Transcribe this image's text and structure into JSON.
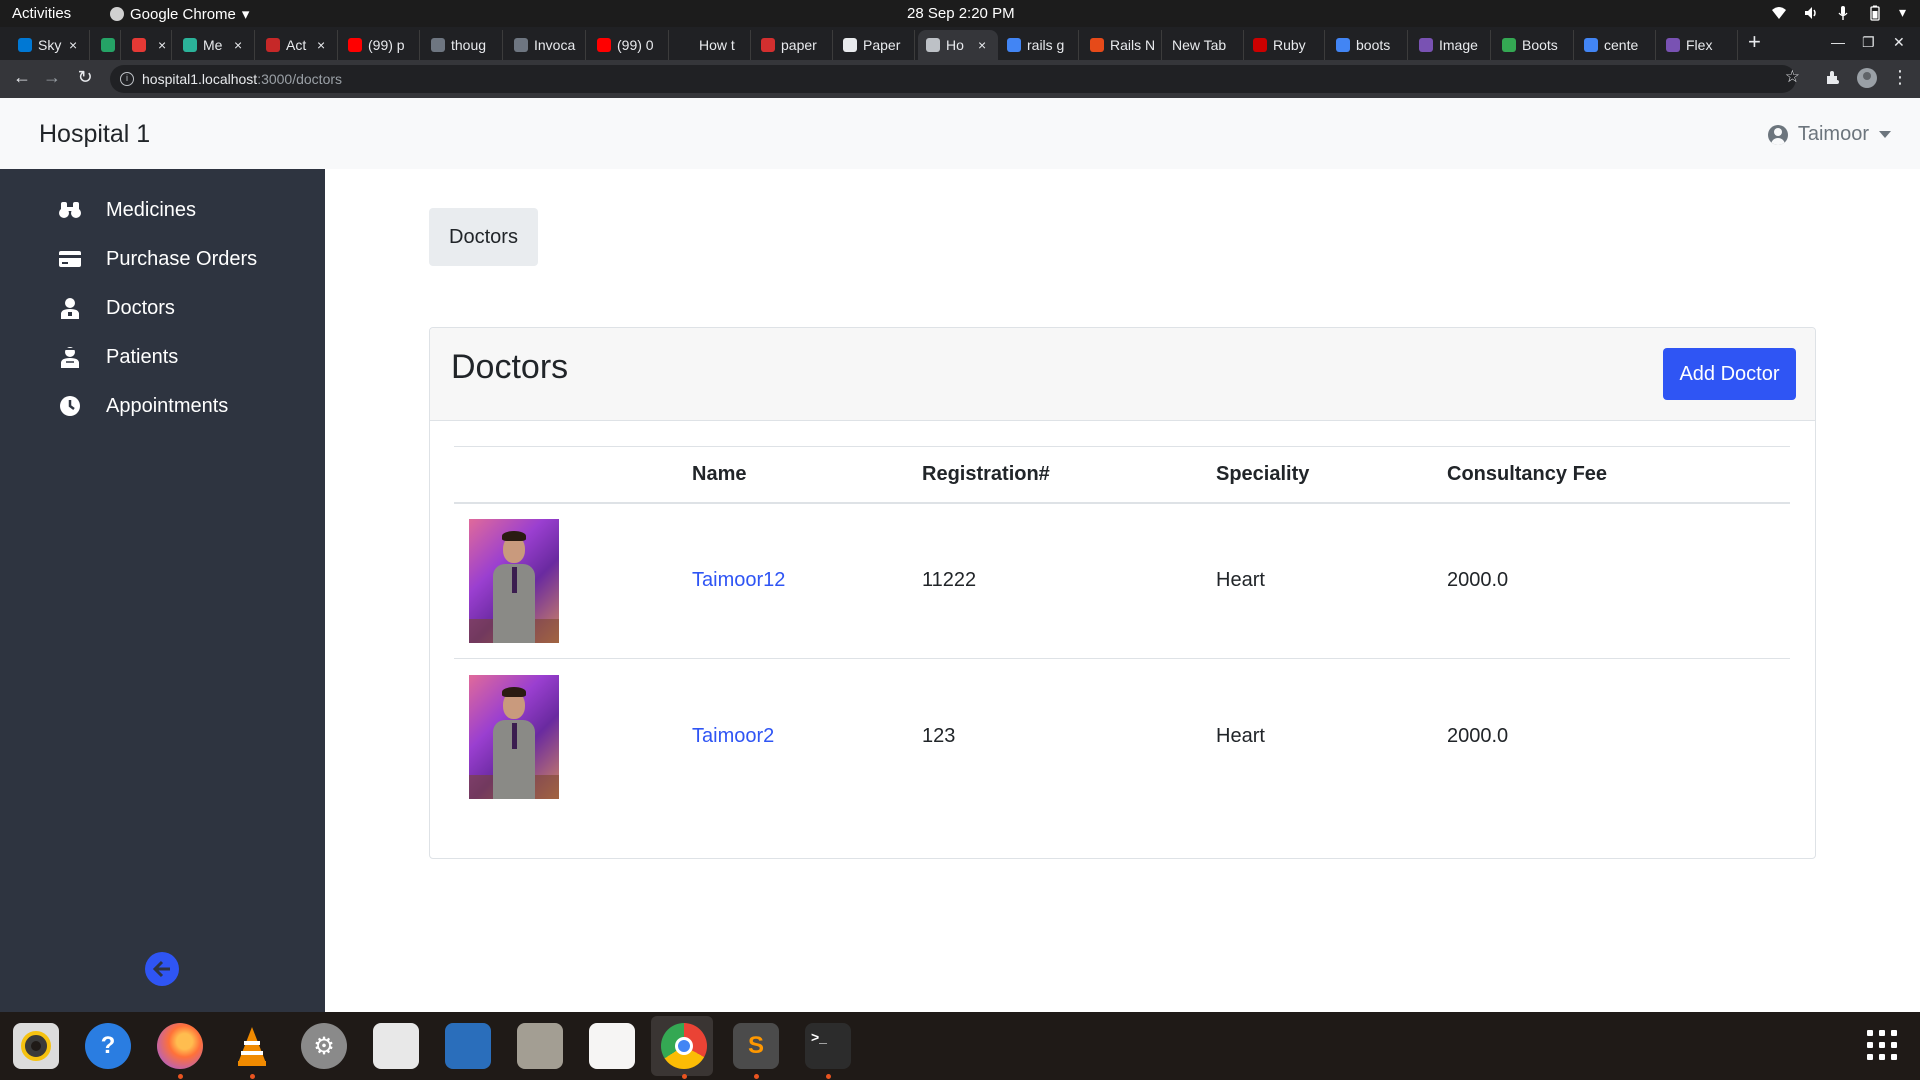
{
  "system": {
    "activities": "Activities",
    "app_name": "Google Chrome",
    "clock": "28 Sep  2:20 PM"
  },
  "browser": {
    "tabs": [
      {
        "label": "Sky",
        "fav_color": "#0078d4",
        "close": "×"
      },
      {
        "label": "",
        "fav_color": "#25a366",
        "close": ""
      },
      {
        "label": "",
        "fav_color": "#e53935",
        "close": "×"
      },
      {
        "label": "Me",
        "fav_color": "#2bb39a",
        "close": "×"
      },
      {
        "label": "Act",
        "fav_color": "#c62828",
        "close": "×"
      },
      {
        "label": "(99) p",
        "fav_color": "#ff0000",
        "close": ""
      },
      {
        "label": "thoug",
        "fav_color": "#6e7681",
        "close": ""
      },
      {
        "label": "Invoca",
        "fav_color": "#6e7681",
        "close": ""
      },
      {
        "label": "(99) 0",
        "fav_color": "#ff0000",
        "close": ""
      },
      {
        "label": "How t",
        "fav_color": "#202124",
        "close": ""
      },
      {
        "label": "paper",
        "fav_color": "#d32f2f",
        "close": ""
      },
      {
        "label": "Paper",
        "fav_color": "#e8eaed",
        "close": ""
      },
      {
        "label": "Ho",
        "fav_color": "#bdc1c6",
        "close": "×"
      },
      {
        "label": "rails g",
        "fav_color": "#4285f4",
        "close": ""
      },
      {
        "label": "Rails N",
        "fav_color": "#e64a19",
        "close": ""
      },
      {
        "label": "New Tab",
        "fav_color": "",
        "close": ""
      },
      {
        "label": "Ruby",
        "fav_color": "#cc0000",
        "close": ""
      },
      {
        "label": "boots",
        "fav_color": "#4285f4",
        "close": ""
      },
      {
        "label": "Image",
        "fav_color": "#7952b3",
        "close": ""
      },
      {
        "label": "Boots",
        "fav_color": "#34a853",
        "close": ""
      },
      {
        "label": "cente",
        "fav_color": "#4285f4",
        "close": ""
      },
      {
        "label": "Flex",
        "fav_color": "#7952b3",
        "close": ""
      }
    ],
    "new_tab": "+",
    "url_host": "hospital1.localhost",
    "url_path": ":3000/doctors"
  },
  "app": {
    "brand": "Hospital 1",
    "user": "Taimoor"
  },
  "sidebar": {
    "items": [
      {
        "label": "Medicines",
        "icon": "binoculars-icon"
      },
      {
        "label": "Purchase Orders",
        "icon": "credit-card-icon"
      },
      {
        "label": "Doctors",
        "icon": "doctor-icon"
      },
      {
        "label": "Patients",
        "icon": "patient-icon"
      },
      {
        "label": "Appointments",
        "icon": "clock-icon"
      }
    ]
  },
  "main": {
    "breadcrumb": "Doctors",
    "card_title": "Doctors",
    "add_button": "Add Doctor",
    "columns": [
      "",
      "Name",
      "Registration#",
      "Speciality",
      "Consultancy Fee"
    ],
    "rows": [
      {
        "name": "Taimoor12",
        "registration": "11222",
        "speciality": "Heart",
        "fee": "2000.0"
      },
      {
        "name": "Taimoor2",
        "registration": "123",
        "speciality": "Heart",
        "fee": "2000.0"
      }
    ]
  },
  "dock": {
    "apps": [
      {
        "name": "rhythmbox-icon",
        "color": "#f5c211"
      },
      {
        "name": "help-icon",
        "color": "#2a7de1"
      },
      {
        "name": "firefox-icon",
        "color": "#ff7139"
      },
      {
        "name": "vlc-icon",
        "color": "#f08a00"
      },
      {
        "name": "settings-icon",
        "color": "#8a8a8a"
      },
      {
        "name": "document-viewer-icon",
        "color": "#e8e8e8"
      },
      {
        "name": "writer-icon",
        "color": "#2a6ebb"
      },
      {
        "name": "files-icon",
        "color": "#a39e93"
      },
      {
        "name": "text-editor-icon",
        "color": "#f6f5f4"
      },
      {
        "name": "chrome-icon",
        "color": "#4285f4"
      },
      {
        "name": "sublime-icon",
        "color": "#4b4b4b"
      },
      {
        "name": "terminal-icon",
        "color": "#2c2c2c"
      }
    ]
  }
}
